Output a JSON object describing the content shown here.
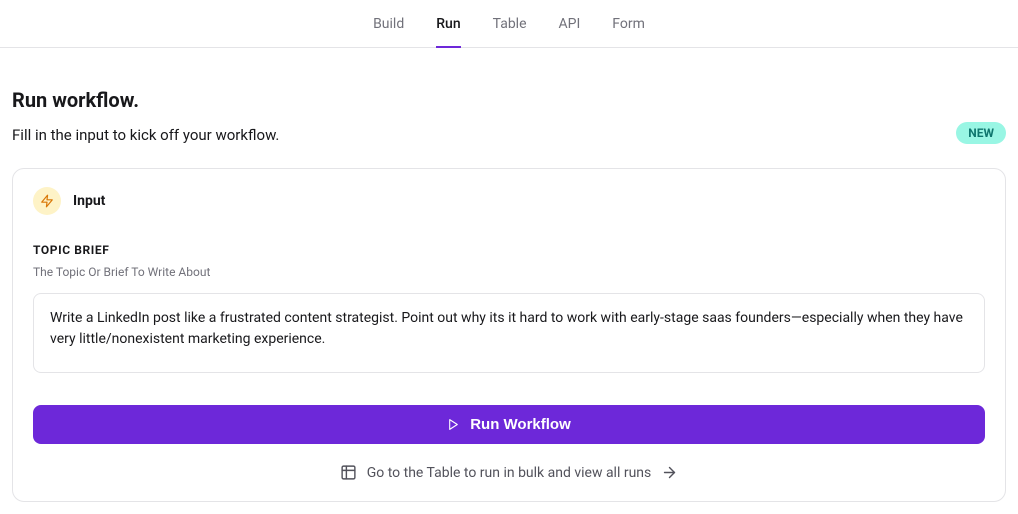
{
  "tabs": {
    "items": [
      "Build",
      "Run",
      "Table",
      "API",
      "Form"
    ],
    "active_index": 1
  },
  "header": {
    "title": "Run workflow.",
    "subtitle": "Fill in the input to kick off your workflow.",
    "badge": "NEW"
  },
  "input_card": {
    "title": "Input",
    "field_label": "TOPIC BRIEF",
    "field_desc": "The Topic Or Brief To Write About",
    "value": "Write a LinkedIn post like a frustrated content strategist. Point out why its it hard to work with early-stage saas founders—especially when they have very little/nonexistent marketing experience."
  },
  "actions": {
    "run_label": "Run Workflow",
    "footer_text": "Go to the Table to run in bulk and view all runs"
  },
  "colors": {
    "accent": "#6d28d9",
    "badge_bg": "#99f6e4",
    "badge_fg": "#0f766e",
    "icon_bg": "#fef3c7",
    "icon_fg": "#d97706"
  }
}
